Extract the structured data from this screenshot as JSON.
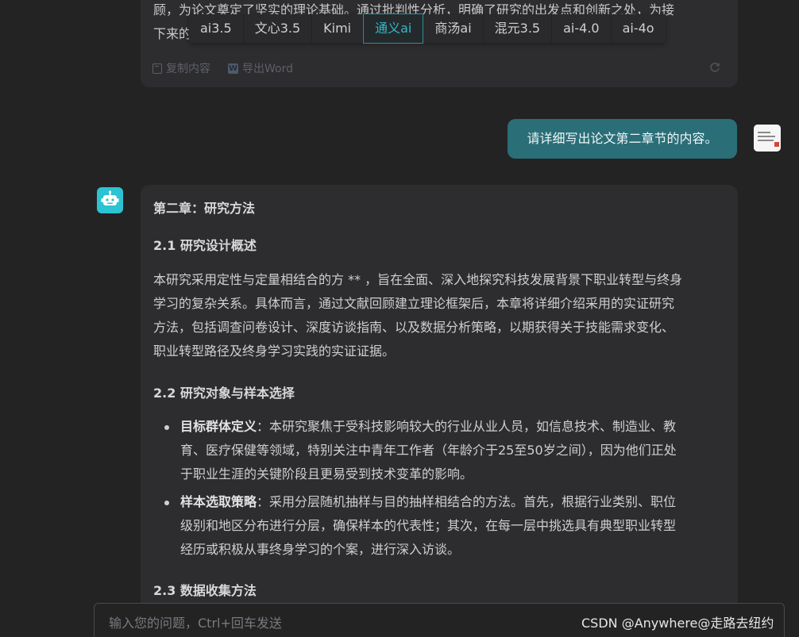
{
  "previous_answer": {
    "lines": [
      "顾，为论文奠定了坚实的理论基础。通过批判性分析，明确了研究的出发点和创新之处，为接",
      "下来的"
    ],
    "model_tabs": [
      {
        "label": "ai3.5",
        "active": false
      },
      {
        "label": "文心3.5",
        "active": false
      },
      {
        "label": "Kimi",
        "active": false
      },
      {
        "label": "通义ai",
        "active": true
      },
      {
        "label": "商汤ai",
        "active": false
      },
      {
        "label": "混元3.5",
        "active": false
      },
      {
        "label": "ai-4.0",
        "active": false
      },
      {
        "label": "ai-4o",
        "active": false
      }
    ],
    "actions": {
      "copy_label": "复制内容",
      "export_label": "导出Word"
    }
  },
  "user_message": {
    "text": "请详细写出论文第二章节的内容。"
  },
  "answer": {
    "chapter_title": "第二章：研究方法",
    "s1_title": "2.1 研究设计概述",
    "s1_lines": [
      "本研究采用定性与定量相结合的方 ** ，旨在全面、深入地探究科技发展背景下职业转型与终身",
      "学习的复杂关系。具体而言，通过文献回顾建立理论框架后，本章将详细介绍采用的实证研究",
      "方法，包括调查问卷设计、深度访谈指南、以及数据分析策略，以期获得关于技能需求变化、",
      "职业转型路径及终身学习实践的实证证据。"
    ],
    "s2_title": "2.2 研究对象与样本选择",
    "bullets": [
      {
        "label": "目标群体定义",
        "lines": [
          "：本研究聚焦于受科技影响较大的行业从业人员，如信息技术、制造业、教",
          "育、医疗保健等领域，特别关注中青年工作者（年龄介于25至50岁之间），因为他们正处",
          "于职业生涯的关键阶段且更易受到技术变革的影响。"
        ]
      },
      {
        "label": "样本选取策略",
        "lines": [
          "：采用分层随机抽样与目的抽样相结合的方法。首先，根据行业类别、职位",
          "级别和地区分布进行分层，确保样本的代表性；其次，在每一层中挑选具有典型职业转型",
          "经历或积极从事终身学习的个案，进行深入访谈。"
        ]
      }
    ],
    "s3_title": "2.3 数据收集方法"
  },
  "input": {
    "placeholder": "输入您的问题，Ctrl+回车发送",
    "value": ""
  },
  "watermark": "CSDN @Anywhere@走路去纽约",
  "colors": {
    "accent": "#2a6e78",
    "active_tab": "#35b8c6",
    "bot_avatar": "#2cc3d2",
    "card_bg": "#2d2d30",
    "page_bg": "#232324"
  }
}
